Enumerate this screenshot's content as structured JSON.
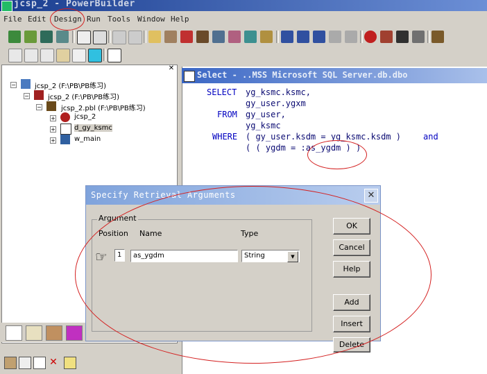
{
  "window": {
    "title": "jcsp_2 - PowerBuilder"
  },
  "menubar": {
    "items": [
      "File",
      "Edit",
      "Design",
      "Run",
      "Tools",
      "Window",
      "Help"
    ]
  },
  "tree": {
    "nodes": [
      {
        "label": "jcsp_2 (F:\\PB\\PB练习)"
      },
      {
        "label": "jcsp_2 (F:\\PB\\PB练习)"
      },
      {
        "label": "jcsp_2.pbl (F:\\PB\\PB练习)"
      },
      {
        "label": "jcsp_2"
      },
      {
        "label": "d_gy_ksmc"
      },
      {
        "label": "w_main"
      }
    ]
  },
  "sql_painter": {
    "title": "Select - ..MSS Microsoft SQL Server.db.dbo",
    "lines": [
      {
        "kw": "SELECT",
        "text": "yg_ksmc.ksmc,"
      },
      {
        "kw": "",
        "text": "gy_user.ygxm"
      },
      {
        "kw": "FROM",
        "text": "gy_user,"
      },
      {
        "kw": "",
        "text": "yg_ksmc"
      },
      {
        "kw": "WHERE",
        "text": "( gy_user.ksdm = yg_ksmc.ksdm )",
        "tail": "and"
      },
      {
        "kw": "",
        "text": "( ( ygdm = :as_ygdm ) )"
      }
    ]
  },
  "dialog": {
    "title": "Specify Retrieval Arguments",
    "close_symbol": "✕",
    "group_label": "Argument",
    "headers": {
      "position": "Position",
      "name": "Name",
      "type": "Type"
    },
    "argument": {
      "position": "1",
      "name": "as_ygdm",
      "type": "String"
    },
    "buttons": {
      "ok": "OK",
      "cancel": "Cancel",
      "help": "Help",
      "add": "Add",
      "insert": "Insert",
      "delete": "Delete"
    }
  },
  "colors": {
    "annotation": "#d42020",
    "sql_keyword": "#0000c0",
    "sql_text": "#0a0a72"
  }
}
